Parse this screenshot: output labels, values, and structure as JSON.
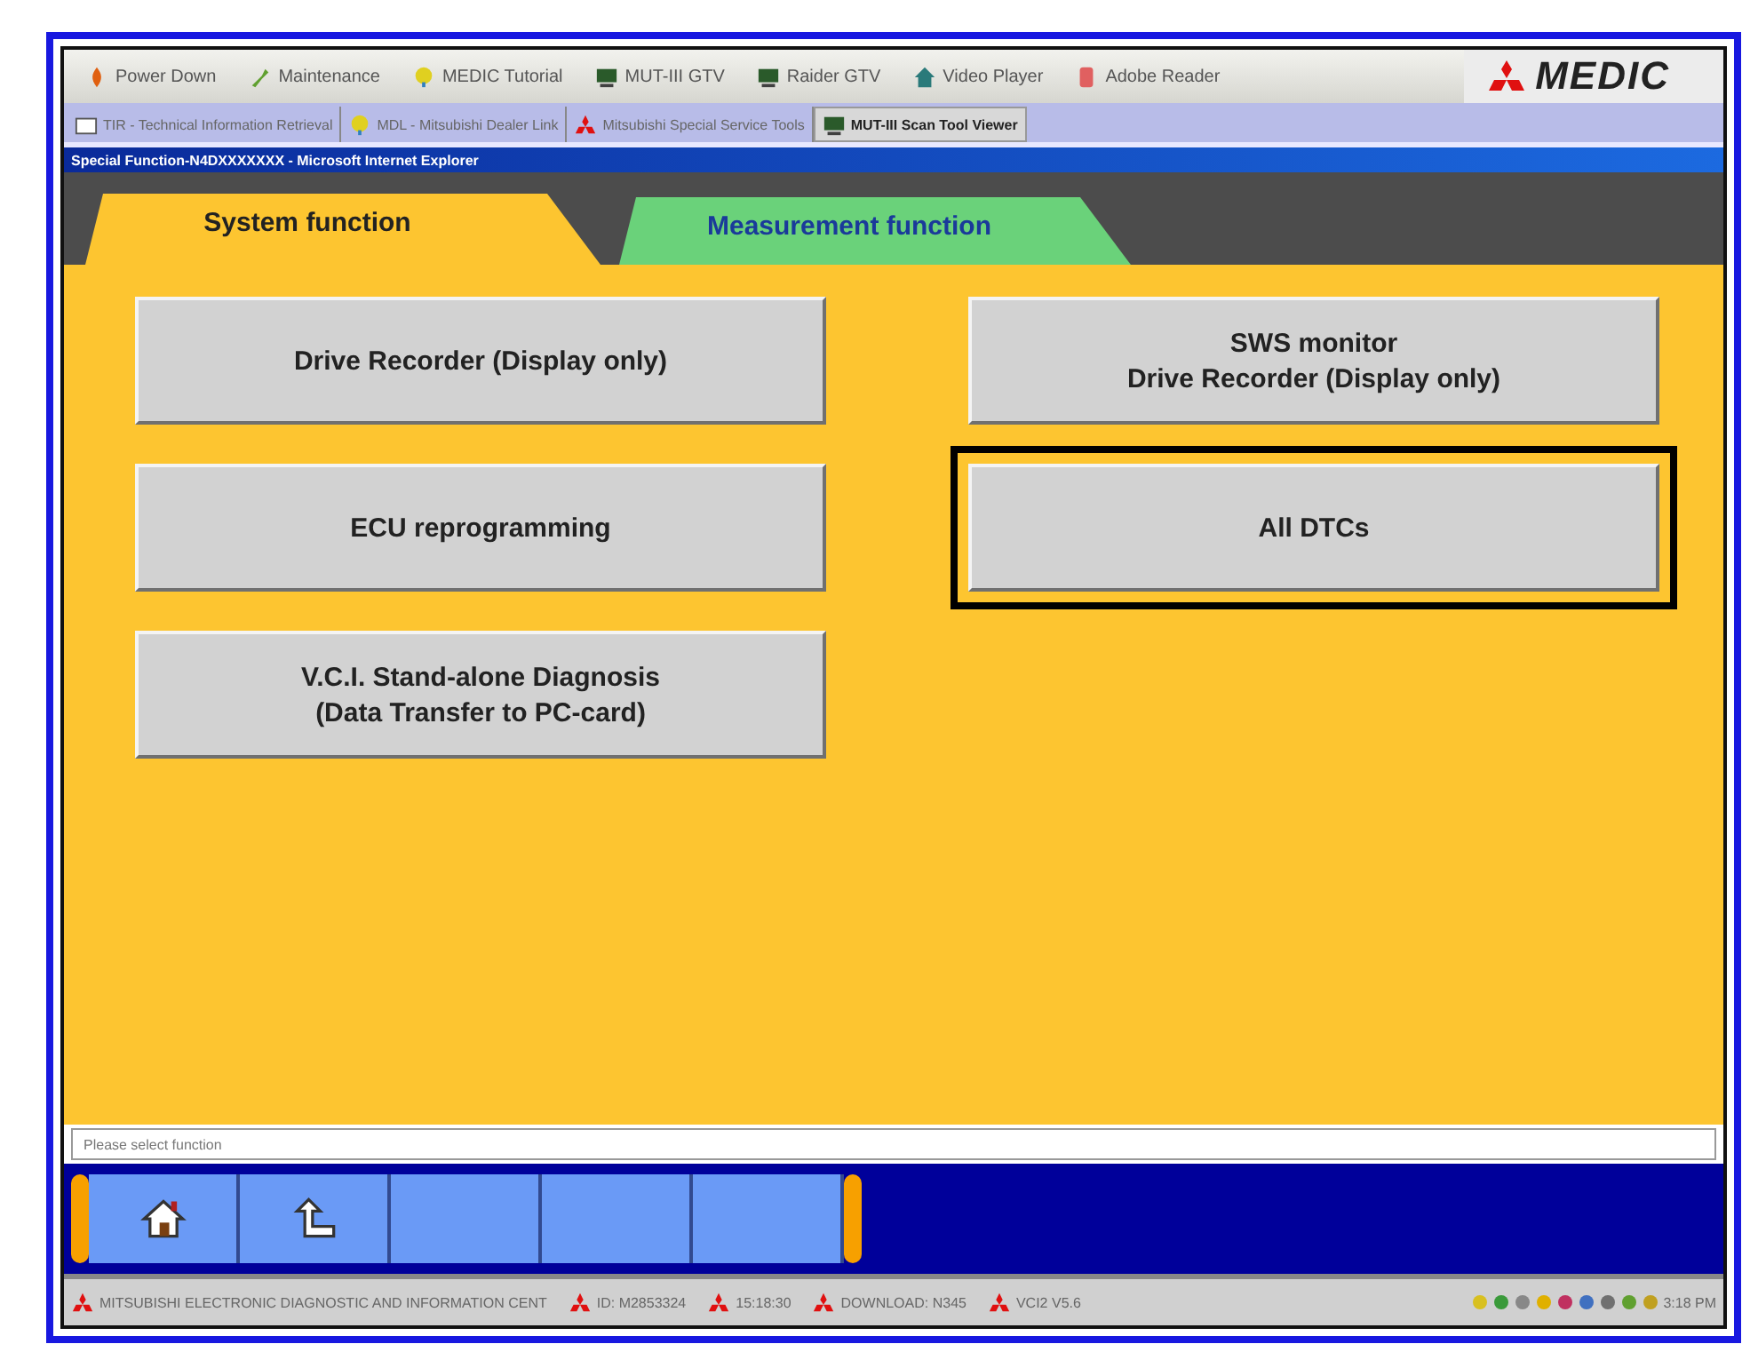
{
  "toolbar": {
    "items": [
      {
        "label": "Power Down"
      },
      {
        "label": "Maintenance"
      },
      {
        "label": "MEDIC Tutorial"
      },
      {
        "label": "MUT-III GTV"
      },
      {
        "label": "Raider GTV"
      },
      {
        "label": "Video Player"
      },
      {
        "label": "Adobe Reader"
      }
    ],
    "logo": "MEDIC"
  },
  "app_tabs": [
    {
      "label": "TIR - Technical Information Retrieval",
      "selected": false
    },
    {
      "label": "MDL - Mitsubishi Dealer Link",
      "selected": false
    },
    {
      "label": "Mitsubishi Special Service Tools",
      "selected": false
    },
    {
      "label": "MUT-III Scan Tool Viewer",
      "selected": true
    }
  ],
  "window": {
    "title": "Special Function-N4DXXXXXXX - Microsoft Internet Explorer"
  },
  "function_tabs": [
    {
      "label": "System function",
      "selected": true
    },
    {
      "label": "Measurement function",
      "selected": false
    }
  ],
  "functions": [
    {
      "lines": [
        "Drive Recorder (Display only)"
      ],
      "selected": false
    },
    {
      "lines": [
        "ECU reprogramming"
      ],
      "selected": false
    },
    {
      "lines": [
        "V.C.I. Stand-alone Diagnosis",
        "(Data Transfer to PC-card)"
      ],
      "selected": false
    },
    {
      "lines": [
        "SWS monitor",
        "Drive Recorder (Display only)"
      ],
      "selected": false
    },
    {
      "lines": [
        "All DTCs"
      ],
      "selected": true
    }
  ],
  "status": {
    "message": "Please select function"
  },
  "taskbar": {
    "items": [
      {
        "label": "MITSUBISHI ELECTRONIC DIAGNOSTIC AND INFORMATION CENT"
      },
      {
        "label": "ID: M2853324"
      },
      {
        "label": "15:18:30"
      },
      {
        "label": "DOWNLOAD: N345"
      },
      {
        "label": "VCI2 V5.6"
      }
    ],
    "clock": "3:18 PM"
  }
}
